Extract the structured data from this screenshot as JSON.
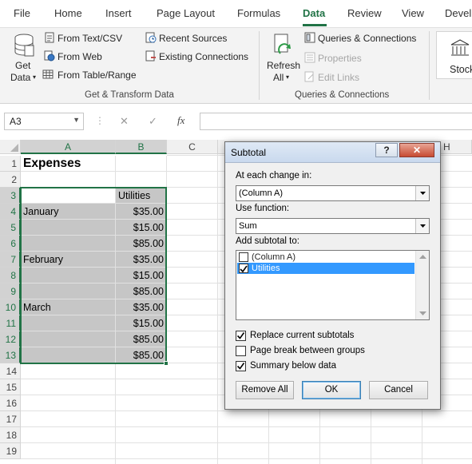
{
  "ribbon_tabs": [
    "File",
    "Home",
    "Insert",
    "Page Layout",
    "Formulas",
    "Data",
    "Review",
    "View",
    "Devel"
  ],
  "active_tab": "Data",
  "accent_color": "#217346",
  "get_transform": {
    "get_data_line1": "Get",
    "get_data_line2": "Data",
    "from_text_csv": "From Text/CSV",
    "from_web": "From Web",
    "from_table_range": "From Table/Range",
    "recent_sources": "Recent Sources",
    "existing_connections": "Existing Connections",
    "group_title": "Get & Transform Data"
  },
  "queries": {
    "refresh_line1": "Refresh",
    "refresh_line2": "All",
    "queries_connections": "Queries & Connections",
    "properties": "Properties",
    "edit_links": "Edit Links",
    "group_title": "Queries & Connections"
  },
  "stock_label": "Stock",
  "formula_bar": {
    "name_box": "A3",
    "cancel_glyph": "✕",
    "enter_glyph": "✓",
    "fx_label": "fx",
    "formula": ""
  },
  "columns": [
    "A",
    "B",
    "C",
    "H"
  ],
  "rows": [
    "1",
    "2",
    "3",
    "4",
    "5",
    "6",
    "7",
    "8",
    "9",
    "10",
    "11",
    "12",
    "13",
    "14",
    "15",
    "16",
    "17",
    "18",
    "19"
  ],
  "cells": {
    "a1": "Expenses",
    "b3": "Utilities",
    "a4": "January",
    "b4": "$35.00",
    "b5": "$15.00",
    "b6": "$85.00",
    "a7": "February",
    "b7": "$35.00",
    "b8": "$15.00",
    "b9": "$85.00",
    "a10": "March",
    "b10": "$35.00",
    "b11": "$15.00",
    "b12": "$85.00",
    "b13": "$85.00"
  },
  "dialog": {
    "title": "Subtotal",
    "help": "?",
    "close": "✕",
    "at_each_change_label": "At each change in:",
    "at_each_change_value": "(Column A)",
    "use_function_label": "Use function:",
    "use_function_value": "Sum",
    "add_subtotal_label": "Add subtotal to:",
    "list_items": [
      {
        "label": "(Column A)",
        "checked": false,
        "selected": false
      },
      {
        "label": "Utilities",
        "checked": true,
        "selected": true
      }
    ],
    "replace_current": {
      "label": "Replace current subtotals",
      "checked": true
    },
    "page_break": {
      "label": "Page break between groups",
      "checked": false
    },
    "summary_below": {
      "label": "Summary below data",
      "checked": true
    },
    "remove_all": "Remove All",
    "ok": "OK",
    "cancel": "Cancel"
  }
}
